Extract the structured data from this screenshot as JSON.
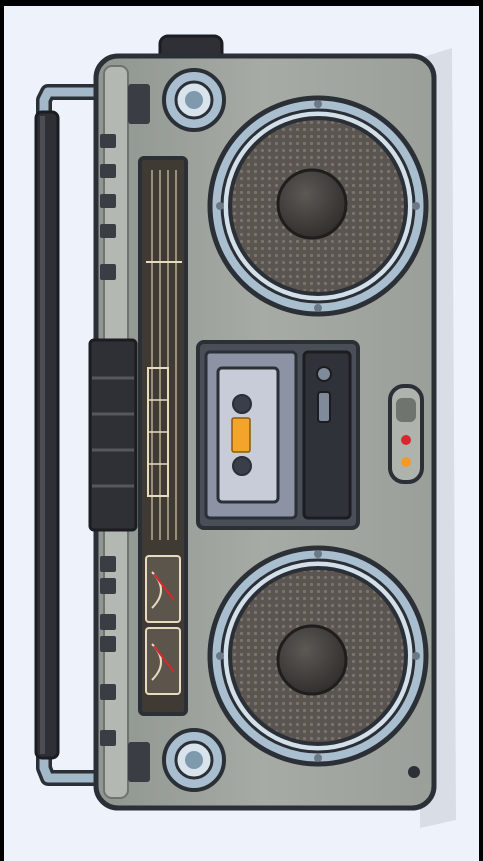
{
  "scene": {
    "subject": "boombox-illustration",
    "orientation": "rotated-vertical",
    "colors": {
      "background": "#eef3fb",
      "frame": "#000000",
      "body": "#9ea39d",
      "body_dark": "#6f746e",
      "outline": "#2b2f36",
      "speaker_ring": "#a9bfd0",
      "speaker_mesh": "#5a5550",
      "speaker_dome": "#3e3c39",
      "display": "#3f3a33",
      "cassette_panel": "#4a4f57",
      "cassette_window": "#8d92a4",
      "cassette_label": "#f2a52a",
      "led_red": "#d9262c",
      "led_orange": "#f39a24",
      "handle": "#a3b8c8",
      "grip": "#2e3035"
    }
  }
}
